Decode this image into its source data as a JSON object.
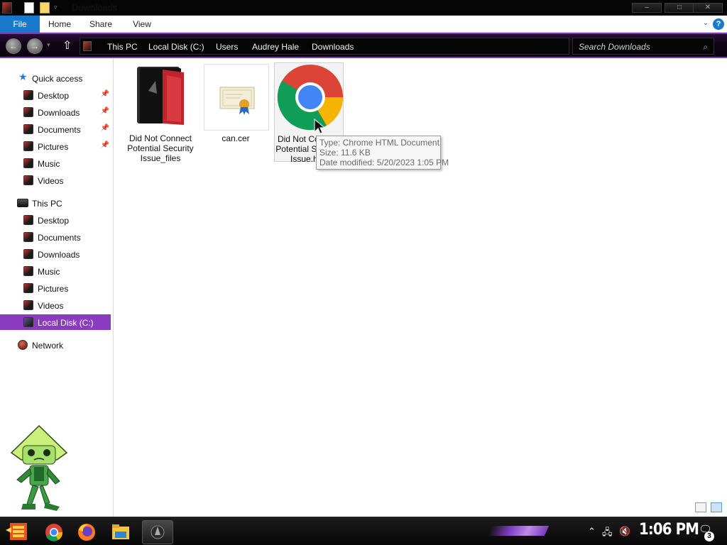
{
  "window": {
    "title": "Downloads",
    "minimize_glyph": "‒",
    "maximize_glyph": "□",
    "close_glyph": "✕"
  },
  "ribbon": {
    "tabs": [
      "File",
      "Home",
      "Share",
      "View"
    ],
    "help_glyph": "?"
  },
  "address": {
    "back_glyph": "←",
    "forward_glyph": "→",
    "up_glyph": "⇧",
    "breadcrumbs": [
      "This PC",
      "Local Disk (C:)",
      "Users",
      "Audrey Hale",
      "Downloads"
    ],
    "search_placeholder": "Search Downloads"
  },
  "nav": {
    "quick_access_label": "Quick access",
    "quick_access": [
      {
        "label": "Desktop",
        "pinned": true
      },
      {
        "label": "Downloads",
        "pinned": true
      },
      {
        "label": "Documents",
        "pinned": true
      },
      {
        "label": "Pictures",
        "pinned": true
      },
      {
        "label": "Music",
        "pinned": false
      },
      {
        "label": "Videos",
        "pinned": false
      }
    ],
    "this_pc_label": "This PC",
    "this_pc": [
      "Desktop",
      "Documents",
      "Downloads",
      "Music",
      "Pictures",
      "Videos",
      "Local Disk (C:)"
    ],
    "network_label": "Network",
    "pin_glyph": "📌"
  },
  "files": [
    {
      "name": "Did Not Connect Potential Security Issue_files",
      "icon": "folder-icon"
    },
    {
      "name": "can.cer",
      "icon": "certificate-icon"
    },
    {
      "name": "Did Not Connect Potential Security Issue.htm",
      "icon": "chrome-icon"
    }
  ],
  "tooltip": {
    "type": "Type: Chrome HTML Document",
    "size": "Size: 11.6 KB",
    "modified": "Date modified: 5/20/2023 1:05 PM"
  },
  "taskbar": {
    "clock": "1:06 PM",
    "notification_count": "3"
  },
  "colors": {
    "accent_purple": "#8a3bbf",
    "file_tab_blue": "#1979ca"
  }
}
